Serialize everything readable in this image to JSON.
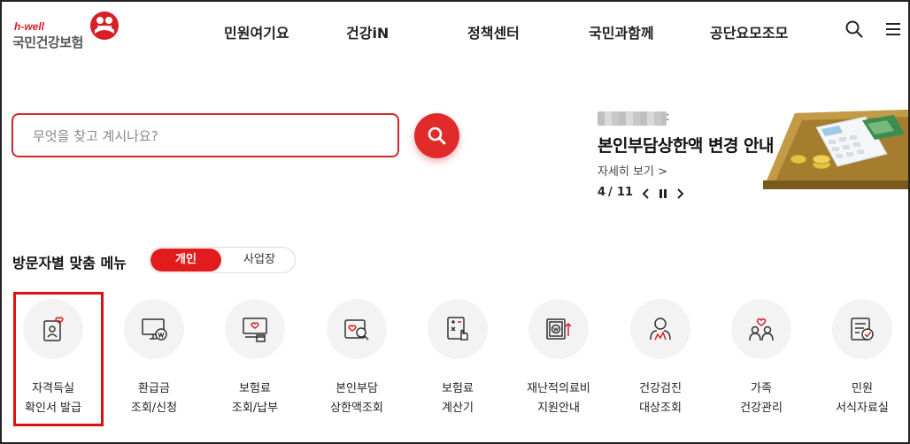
{
  "brand": {
    "tagline": "h-well",
    "name": "국민건강보험",
    "accent": "#e12a2a"
  },
  "gnb": [
    "민원여기요",
    "건강iN",
    "정책센터",
    "국민과함께",
    "공단요모조모"
  ],
  "header_icons": [
    "search-icon",
    "hamburger-menu-icon"
  ],
  "search": {
    "placeholder": "무엇을 찾고 계시나요?",
    "value": ""
  },
  "banner": {
    "title": "본인부담상한액 변경 안내",
    "more": "자세히 보기 >",
    "current": "4",
    "total": "11",
    "separator": "/"
  },
  "visitor_menu": {
    "title": "방문자별 맞춤 메뉴",
    "tabs": [
      "개인",
      "사업장"
    ],
    "active_tab": "개인",
    "items": [
      {
        "line1": "자격득실",
        "line2": "확인서 발급",
        "icon": "id-card-icon"
      },
      {
        "line1": "환급금",
        "line2": "조회/신청",
        "icon": "monitor-won-icon"
      },
      {
        "line1": "보험료",
        "line2": "조회/납부",
        "icon": "payment-screen-icon"
      },
      {
        "line1": "본인부담",
        "line2": "상한액조회",
        "icon": "search-heart-icon"
      },
      {
        "line1": "보험료",
        "line2": "계산기",
        "icon": "calculator-icon"
      },
      {
        "line1": "재난적의료비",
        "line2": "지원안내",
        "icon": "won-support-icon"
      },
      {
        "line1": "건강검진",
        "line2": "대상조회",
        "icon": "health-checkup-icon"
      },
      {
        "line1": "가족",
        "line2": "건강관리",
        "icon": "family-heart-icon"
      },
      {
        "line1": "민원",
        "line2": "서식자료실",
        "icon": "document-check-icon"
      }
    ]
  }
}
